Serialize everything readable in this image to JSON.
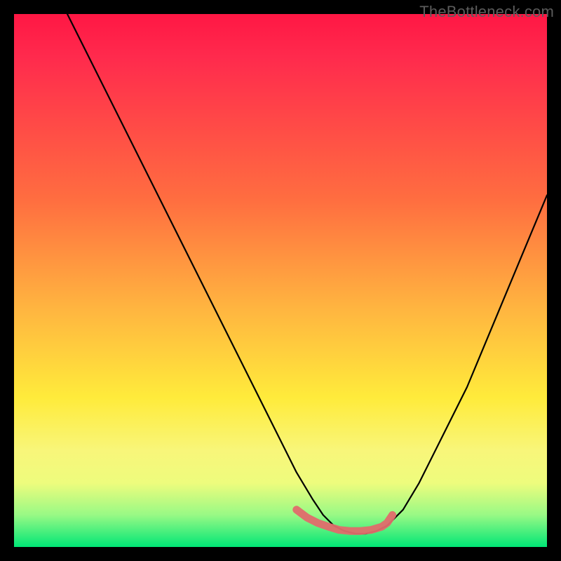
{
  "watermark": "TheBottleneck.com",
  "chart_data": {
    "type": "line",
    "title": "",
    "xlabel": "",
    "ylabel": "",
    "xlim": [
      0,
      100
    ],
    "ylim": [
      0,
      100
    ],
    "grid": false,
    "series": [
      {
        "name": "bottleneck-curve",
        "color": "#000000",
        "x": [
          10,
          15,
          20,
          25,
          30,
          35,
          40,
          45,
          50,
          53,
          56,
          58,
          60,
          62,
          64,
          66,
          68,
          70,
          73,
          76,
          80,
          85,
          90,
          95,
          100
        ],
        "y": [
          100,
          90,
          80,
          70,
          60,
          50,
          40,
          30,
          20,
          14,
          9,
          6,
          4,
          3,
          2.5,
          2.5,
          3,
          4,
          7,
          12,
          20,
          30,
          42,
          54,
          66
        ]
      }
    ],
    "highlight": {
      "name": "bottom-flat-region",
      "color": "#e57373",
      "x": [
        53,
        55,
        57,
        59,
        61,
        63,
        65,
        67,
        69,
        70,
        71
      ],
      "y": [
        7,
        5.5,
        4.5,
        3.8,
        3.2,
        3,
        3,
        3.2,
        3.8,
        4.5,
        6
      ]
    },
    "gradient_stops": [
      {
        "offset": 0,
        "color": "#ff1744"
      },
      {
        "offset": 35,
        "color": "#ff6e40"
      },
      {
        "offset": 72,
        "color": "#ffeb3b"
      },
      {
        "offset": 100,
        "color": "#00e676"
      }
    ]
  }
}
